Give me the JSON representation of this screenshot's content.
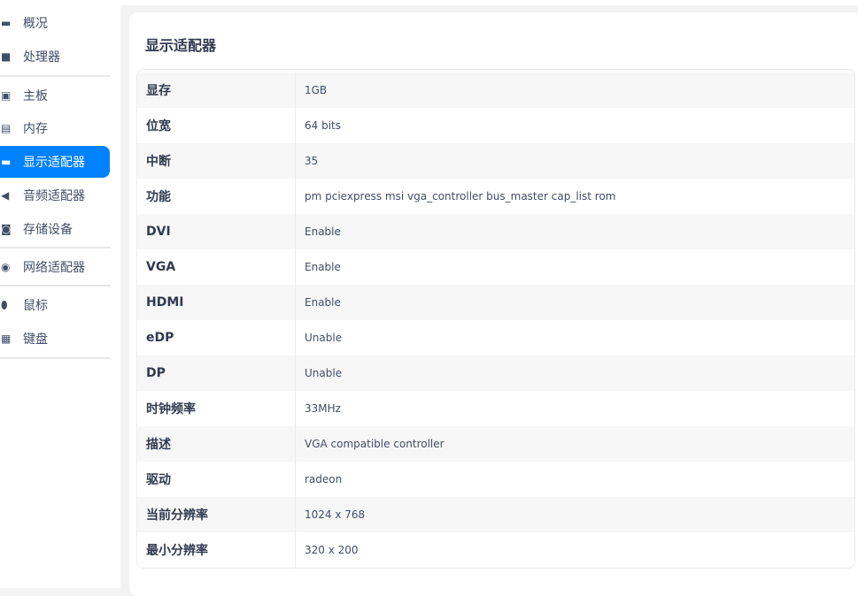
{
  "sidebar": {
    "items": [
      {
        "label": "概况",
        "icon": "computer-icon"
      },
      {
        "label": "处理器",
        "icon": "cpu-icon"
      },
      {
        "label": "主板",
        "icon": "motherboard-icon"
      },
      {
        "label": "内存",
        "icon": "memory-icon"
      },
      {
        "label": "显示适配器",
        "icon": "display-icon",
        "active": true
      },
      {
        "label": "音频适配器",
        "icon": "speaker-icon"
      },
      {
        "label": "存储设备",
        "icon": "disk-icon"
      },
      {
        "label": "网络适配器",
        "icon": "network-icon"
      },
      {
        "label": "鼠标",
        "icon": "mouse-icon"
      },
      {
        "label": "键盘",
        "icon": "keyboard-icon"
      }
    ]
  },
  "accent": "#0081ff",
  "main": {
    "title": "显示适配器",
    "rows": [
      {
        "key": "显存",
        "value": "1GB"
      },
      {
        "key": "位宽",
        "value": "64 bits"
      },
      {
        "key": "中断",
        "value": "35"
      },
      {
        "key": "功能",
        "value": "pm pciexpress msi vga_controller bus_master cap_list rom"
      },
      {
        "key": "DVI",
        "value": "Enable"
      },
      {
        "key": "VGA",
        "value": "Enable"
      },
      {
        "key": "HDMI",
        "value": "Enable"
      },
      {
        "key": "eDP",
        "value": "Unable"
      },
      {
        "key": "DP",
        "value": "Unable"
      },
      {
        "key": "时钟频率",
        "value": "33MHz"
      },
      {
        "key": "描述",
        "value": "VGA compatible controller"
      },
      {
        "key": "驱动",
        "value": "radeon"
      },
      {
        "key": "当前分辨率",
        "value": "1024 x 768"
      },
      {
        "key": "最小分辨率",
        "value": "320 x 200"
      }
    ]
  }
}
